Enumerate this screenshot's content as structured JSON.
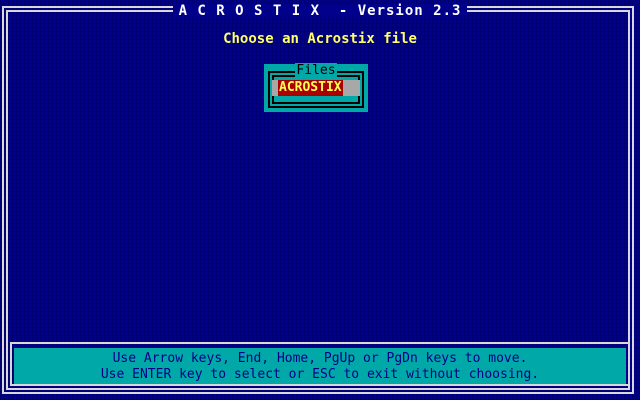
{
  "window": {
    "title": "A C R O S T I X  - Version 2.3"
  },
  "main": {
    "prompt": "Choose an Acrostix file"
  },
  "file_picker": {
    "label": "Files",
    "files": [
      "ACROSTIX"
    ],
    "selected_index": 0
  },
  "help": {
    "line1": "Use Arrow keys, End, Home, PgUp or PgDn keys to move.",
    "line2": "Use ENTER key to select or ESC to exit without choosing."
  },
  "colors": {
    "background": "#00008a",
    "frame": "#d8d8d8",
    "prompt_text": "#ffff66",
    "panel": "#00a8a8",
    "selection_bg": "#aa0000",
    "selection_text": "#ffff55",
    "selection_bar": "#a8a8a8",
    "help_text": "#000088"
  }
}
